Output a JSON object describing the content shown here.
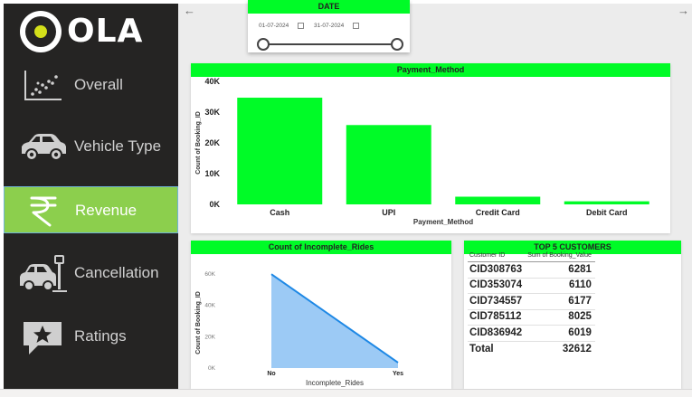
{
  "brand": {
    "logo_text": "OLA"
  },
  "nav": {
    "items": [
      {
        "label": "Overall",
        "icon": "scatter-chart-icon",
        "active": false
      },
      {
        "label": "Vehicle Type",
        "icon": "car-icon",
        "active": false
      },
      {
        "label": "Revenue",
        "icon": "rupee-icon",
        "active": true
      },
      {
        "label": "Cancellation",
        "icon": "car-crash-icon",
        "active": false
      },
      {
        "label": "Ratings",
        "icon": "star-review-icon",
        "active": false
      }
    ]
  },
  "colors": {
    "accent": "#00fb27",
    "sidebar": "#252423",
    "active_nav": "#8ccf4d",
    "area_fill": "#9ccaf5",
    "area_line": "#1e88e5"
  },
  "navigation": {
    "back_icon": "left-arrow-icon",
    "forward_icon": "right-arrow-icon",
    "back_glyph": "←",
    "forward_glyph": "→"
  },
  "date_filter": {
    "title": "DATE",
    "start": "01-07-2024",
    "end": "31-07-2024"
  },
  "payment_chart": {
    "title": "Payment_Method",
    "chart_data": {
      "type": "bar",
      "categories": [
        "Cash",
        "UPI",
        "Credit Card",
        "Debit Card"
      ],
      "values": [
        34700,
        25800,
        2500,
        1000
      ],
      "xlabel": "Payment_Method",
      "ylabel": "Count of Booking_ID",
      "ylim": [
        0,
        40000
      ],
      "yticks": [
        "0K",
        "10K",
        "20K",
        "30K",
        "40K"
      ],
      "color": "#00fb27"
    }
  },
  "incomplete_chart": {
    "title": "Count of Incomplete_Rides",
    "chart_data": {
      "type": "area",
      "categories": [
        "No",
        "Yes"
      ],
      "values": [
        59900,
        3500
      ],
      "xlabel": "Incomplete_Rides",
      "ylabel": "Count of Booking_ID",
      "ylim": [
        0,
        60000
      ],
      "yticks": [
        "0K",
        "20K",
        "40K",
        "60K"
      ]
    }
  },
  "top_customers": {
    "title": "TOP 5 CUSTOMERS",
    "columns": [
      "Customer ID",
      "Sum of Booking_Value"
    ],
    "rows": [
      [
        "CID308763",
        "6281"
      ],
      [
        "CID353074",
        "6110"
      ],
      [
        "CID734557",
        "6177"
      ],
      [
        "CID785112",
        "8025"
      ],
      [
        "CID836942",
        "6019"
      ]
    ],
    "total": [
      "Total",
      "32612"
    ]
  }
}
